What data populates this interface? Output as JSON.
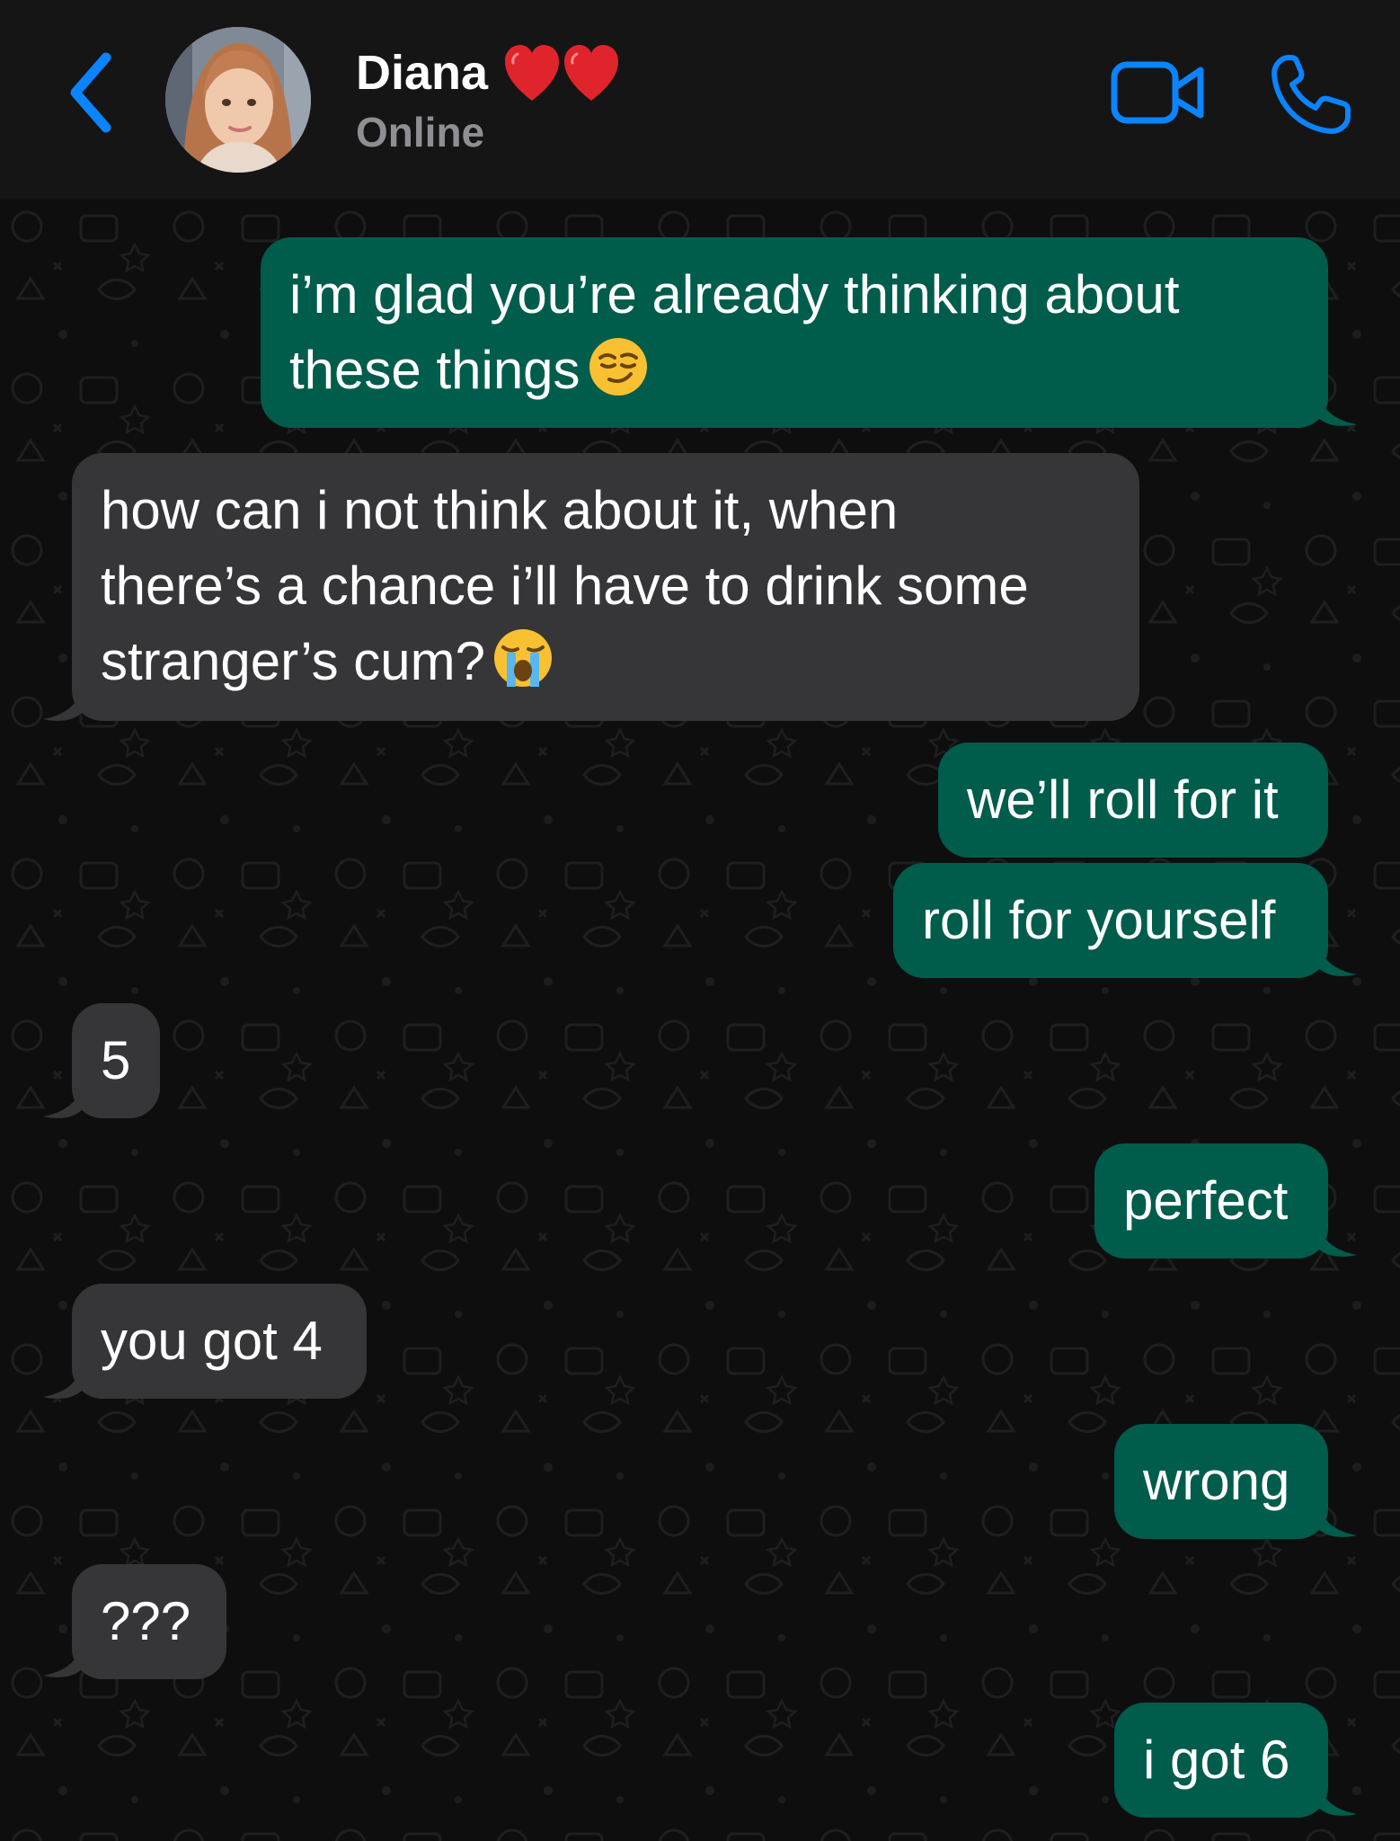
{
  "header": {
    "contact_name": "Diana",
    "name_emoji": "❤️❤️",
    "status": "Online",
    "back_icon": "chevron-left-icon",
    "video_icon": "video-camera-icon",
    "call_icon": "phone-icon",
    "accent_color": "#0a84ff"
  },
  "colors": {
    "outgoing_bubble": "#005c4b",
    "incoming_bubble": "#363638",
    "background": "#0e0e0e",
    "header_background": "#151515"
  },
  "messages": [
    {
      "direction": "outgoing",
      "lines": [
        "i’m glad you’re already thinking about",
        "these things"
      ],
      "emoji": "😏"
    },
    {
      "direction": "incoming",
      "lines": [
        "how can i not think about it, when",
        "there’s a chance i’ll have to drink some",
        "stranger’s cum?"
      ],
      "emoji": "😭"
    },
    {
      "direction": "outgoing",
      "text": "we’ll roll for it"
    },
    {
      "direction": "outgoing",
      "text": "roll for yourself"
    },
    {
      "direction": "incoming",
      "text": "5"
    },
    {
      "direction": "outgoing",
      "text": "perfect"
    },
    {
      "direction": "incoming",
      "text": "you got 4"
    },
    {
      "direction": "outgoing",
      "text": "wrong"
    },
    {
      "direction": "incoming",
      "text": "???"
    },
    {
      "direction": "outgoing",
      "text": "i got 6"
    }
  ]
}
